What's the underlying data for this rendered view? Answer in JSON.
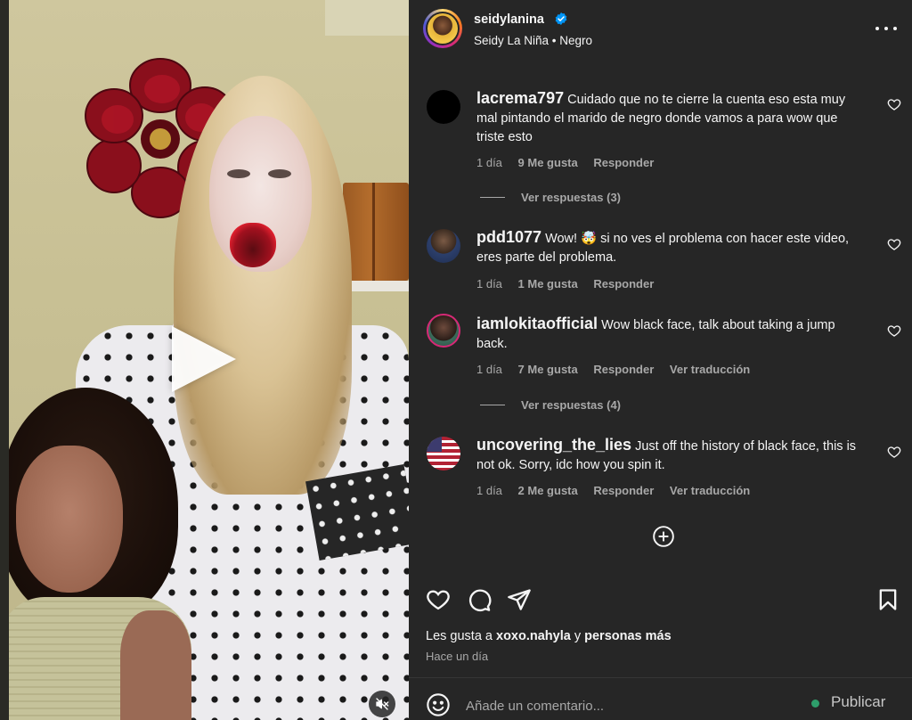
{
  "post": {
    "username": "seidylanina",
    "subtitle": "Seidy La Niña • Negro",
    "verified": true
  },
  "comments": [
    {
      "username": "lacrema797",
      "text": "Cuidado que no te cierre la cuenta eso esta muy mal pintando el marido de negro donde vamos a para wow que triste esto",
      "time": "1 día",
      "likes": "9 Me gusta",
      "reply": "Responder",
      "translate": "",
      "view_replies": "Ver respuestas (3)"
    },
    {
      "username": "pdd1077",
      "text": "Wow! 🤯 si no ves el problema con hacer este video, eres parte del problema.",
      "time": "1 día",
      "likes": "1 Me gusta",
      "reply": "Responder",
      "translate": "",
      "view_replies": ""
    },
    {
      "username": "iamlokitaofficial",
      "text": "Wow black face, talk about taking a jump back.",
      "time": "1 día",
      "likes": "7 Me gusta",
      "reply": "Responder",
      "translate": "Ver traducción",
      "view_replies": "Ver respuestas (4)"
    },
    {
      "username": "uncovering_the_lies",
      "text": "Just off the history of black face, this is not ok. Sorry, idc how you spin it.",
      "time": "1 día",
      "likes": "2 Me gusta",
      "reply": "Responder",
      "translate": "Ver traducción",
      "view_replies": ""
    }
  ],
  "likes_line": {
    "prefix": "Les gusta a",
    "user": "xoxo.nahyla",
    "joiner": "y",
    "others": "personas más"
  },
  "time_ago": "Hace un día",
  "composer": {
    "placeholder": "Añade un comentario...",
    "publish_label": "Publicar"
  },
  "icons": {
    "verified": "verified-badge-icon",
    "more": "more-options-icon",
    "like": "heart-icon",
    "comment": "comment-bubble-icon",
    "share": "paper-plane-icon",
    "save": "bookmark-icon",
    "emoji": "emoji-icon",
    "add": "plus-circle-icon",
    "play": "play-icon",
    "mute": "muted-speaker-icon"
  },
  "colors": {
    "panel_bg": "#262626",
    "text": "#f5f5f5",
    "muted": "#a8a8a8",
    "verified_blue": "#0095f6",
    "online_green": "#2e9e6b"
  }
}
